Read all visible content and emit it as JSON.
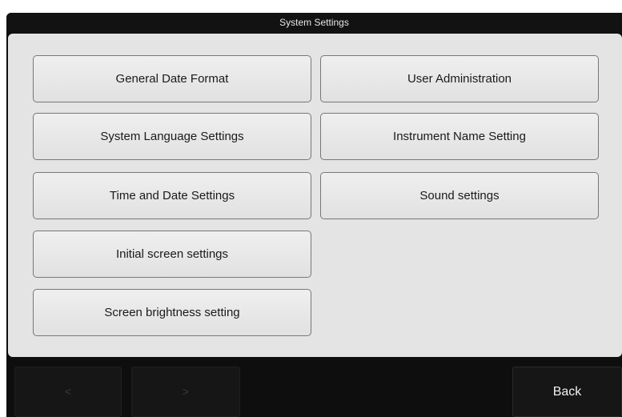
{
  "window": {
    "title": "System Settings"
  },
  "settings": {
    "left_column": [
      {
        "label": "General Date Format"
      },
      {
        "label": "System Language Settings"
      },
      {
        "label": "Time and Date Settings"
      },
      {
        "label": "Initial screen settings"
      },
      {
        "label": "Screen brightness setting"
      }
    ],
    "right_column": [
      {
        "label": "User Administration"
      },
      {
        "label": "Instrument Name Setting"
      },
      {
        "label": "Sound settings"
      }
    ]
  },
  "footer": {
    "prev_glyph": "<",
    "next_glyph": ">",
    "back_label": "Back"
  },
  "colors": {
    "background": "#0e0e0e",
    "panel": "#e4e4e4",
    "button_face": "#e8e8e8",
    "button_border": "#777777"
  }
}
